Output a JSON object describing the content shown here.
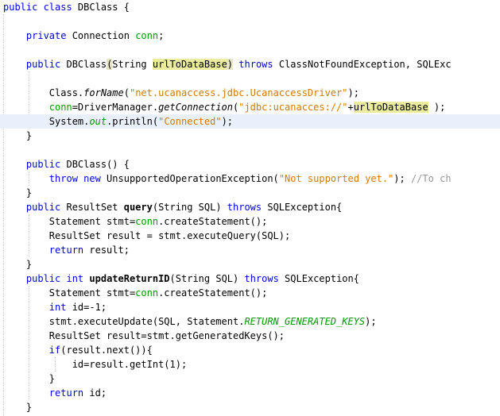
{
  "editor": {
    "lines": [
      [
        {
          "t": "public class ",
          "c": "kw"
        },
        {
          "t": "DBClass {"
        }
      ],
      [],
      [
        {
          "t": "    "
        },
        {
          "t": "private ",
          "c": "kw"
        },
        {
          "t": "Connection "
        },
        {
          "t": "conn",
          "c": "fld"
        },
        {
          "t": ";"
        }
      ],
      [],
      [
        {
          "t": "    "
        },
        {
          "t": "public ",
          "c": "kw"
        },
        {
          "t": "DBClass"
        },
        {
          "t": "(",
          "c": "bracket"
        },
        {
          "t": "String "
        },
        {
          "t": "urlToDataBase",
          "c": "hl"
        },
        {
          "t": ")",
          "c": "bracket"
        },
        {
          "t": " "
        },
        {
          "t": "throws ",
          "c": "kw"
        },
        {
          "t": "ClassNotFoundException, SQLExc"
        }
      ],
      [],
      [
        {
          "t": "        Class."
        },
        {
          "t": "forName",
          "c": "it"
        },
        {
          "t": "("
        },
        {
          "t": "\"net.ucanaccess.jdbc.UcanaccessDriver\"",
          "c": "str"
        },
        {
          "t": ");"
        }
      ],
      [
        {
          "t": "        "
        },
        {
          "t": "conn",
          "c": "fld"
        },
        {
          "t": "=DriverManager."
        },
        {
          "t": "getConnection",
          "c": "it"
        },
        {
          "t": "("
        },
        {
          "t": "\"jdbc:ucanacces://\"",
          "c": "str"
        },
        {
          "t": "+"
        },
        {
          "t": "urlToDataBase",
          "c": "hl"
        },
        {
          "t": " );"
        }
      ],
      [
        {
          "t": "        System."
        },
        {
          "t": "out",
          "c": "sfld"
        },
        {
          "t": ".println("
        },
        {
          "t": "\"Connected\"",
          "c": "str"
        },
        {
          "t": ");"
        }
      ],
      [
        {
          "t": "    }"
        }
      ],
      [],
      [
        {
          "t": "    "
        },
        {
          "t": "public ",
          "c": "kw"
        },
        {
          "t": "DBClass() {"
        }
      ],
      [
        {
          "t": "        "
        },
        {
          "t": "throw new ",
          "c": "kw"
        },
        {
          "t": "UnsupportedOperationException("
        },
        {
          "t": "\"Not supported yet.\"",
          "c": "str"
        },
        {
          "t": "); "
        },
        {
          "t": "//To ch",
          "c": "cmt"
        }
      ],
      [
        {
          "t": "    }"
        }
      ],
      [
        {
          "t": "    "
        },
        {
          "t": "public ",
          "c": "kw"
        },
        {
          "t": "ResultSet "
        },
        {
          "t": "query",
          "c": "b"
        },
        {
          "t": "(String SQL) "
        },
        {
          "t": "throws ",
          "c": "kw"
        },
        {
          "t": "SQLException{"
        }
      ],
      [
        {
          "t": "        Statement stmt="
        },
        {
          "t": "conn",
          "c": "fld"
        },
        {
          "t": ".createStatement();"
        }
      ],
      [
        {
          "t": "        ResultSet result = stmt.executeQuery(SQL);"
        }
      ],
      [
        {
          "t": "        "
        },
        {
          "t": "return ",
          "c": "kw"
        },
        {
          "t": "result;"
        }
      ],
      [
        {
          "t": "    }"
        }
      ],
      [
        {
          "t": "    "
        },
        {
          "t": "public int ",
          "c": "kw"
        },
        {
          "t": "updateReturnID",
          "c": "b"
        },
        {
          "t": "(String SQL) "
        },
        {
          "t": "throws ",
          "c": "kw"
        },
        {
          "t": "SQLException{"
        }
      ],
      [
        {
          "t": "        Statement stmt="
        },
        {
          "t": "conn",
          "c": "fld"
        },
        {
          "t": ".createStatement();"
        }
      ],
      [
        {
          "t": "        "
        },
        {
          "t": "int ",
          "c": "kw"
        },
        {
          "t": "id=-1;"
        }
      ],
      [
        {
          "t": "        stmt.executeUpdate(SQL, Statement."
        },
        {
          "t": "RETURN_GENERATED_KEYS",
          "c": "sfld"
        },
        {
          "t": ");"
        }
      ],
      [
        {
          "t": "        ResultSet result=stmt.getGeneratedKeys();"
        }
      ],
      [
        {
          "t": "        "
        },
        {
          "t": "if",
          "c": "kw"
        },
        {
          "t": "(result.next()){"
        }
      ],
      [
        {
          "t": "            id=result.getInt(1);"
        }
      ],
      [
        {
          "t": "        }"
        }
      ],
      [
        {
          "t": "        "
        },
        {
          "t": "return ",
          "c": "kw"
        },
        {
          "t": "id;"
        }
      ],
      [
        {
          "t": "    }"
        }
      ]
    ],
    "current_line": 8
  }
}
